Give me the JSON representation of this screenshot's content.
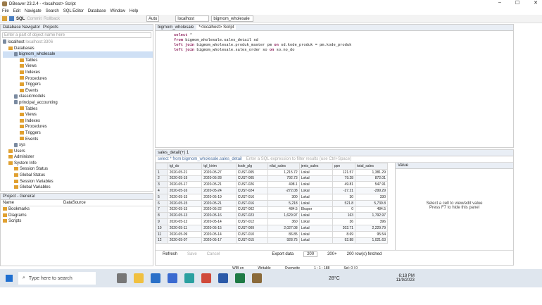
{
  "window": {
    "title": "DBeaver 23.2.4 - <localhost> Script",
    "min": "–",
    "max": "☐",
    "close": "✕"
  },
  "menu": [
    "File",
    "Edit",
    "Navigate",
    "Search",
    "SQL Editor",
    "Database",
    "Window",
    "Help"
  ],
  "toolbar": {
    "sql": "SQL",
    "commit": "Commit",
    "rollback": "Rollback",
    "auto": "Auto",
    "connection": "localhost",
    "schema": "bigmom_wholesale"
  },
  "navigator": {
    "tab1": "Database Navigator",
    "tab2": "Projects",
    "filter_placeholder": "Enter a part of object name here",
    "items": [
      {
        "label": "localhost",
        "note": "localhost:3306",
        "indent": 0,
        "type": "db"
      },
      {
        "label": "Databases",
        "indent": 1,
        "type": "fold"
      },
      {
        "label": "bigmom_wholesale",
        "indent": 2,
        "type": "db",
        "selected": true
      },
      {
        "label": "Tables",
        "indent": 3,
        "type": "fold"
      },
      {
        "label": "Views",
        "indent": 3,
        "type": "fold"
      },
      {
        "label": "Indexes",
        "indent": 3,
        "type": "fold"
      },
      {
        "label": "Procedures",
        "indent": 3,
        "type": "fold"
      },
      {
        "label": "Triggers",
        "indent": 3,
        "type": "fold"
      },
      {
        "label": "Events",
        "indent": 3,
        "type": "fold"
      },
      {
        "label": "classicmodels",
        "indent": 2,
        "type": "db"
      },
      {
        "label": "principal_accounting",
        "indent": 2,
        "type": "db"
      },
      {
        "label": "Tables",
        "indent": 3,
        "type": "fold"
      },
      {
        "label": "Views",
        "indent": 3,
        "type": "fold"
      },
      {
        "label": "Indexes",
        "indent": 3,
        "type": "fold"
      },
      {
        "label": "Procedures",
        "indent": 3,
        "type": "fold"
      },
      {
        "label": "Triggers",
        "indent": 3,
        "type": "fold"
      },
      {
        "label": "Events",
        "indent": 3,
        "type": "fold"
      },
      {
        "label": "sys",
        "indent": 2,
        "type": "db"
      },
      {
        "label": "Users",
        "indent": 1,
        "type": "fold"
      },
      {
        "label": "Administer",
        "indent": 1,
        "type": "fold"
      },
      {
        "label": "System Info",
        "indent": 1,
        "type": "fold"
      },
      {
        "label": "Session Status",
        "indent": 2,
        "type": "fold"
      },
      {
        "label": "Global Status",
        "indent": 2,
        "type": "fold"
      },
      {
        "label": "Session Variables",
        "indent": 2,
        "type": "fold"
      },
      {
        "label": "Global Variables",
        "indent": 2,
        "type": "fold"
      }
    ]
  },
  "project": {
    "title": "Project - General",
    "col1": "Name",
    "col2": "DataSource",
    "items": [
      "Bookmarks",
      "Diagrams",
      "Scripts"
    ]
  },
  "editor": {
    "tab1": "bigmom_wholesale",
    "tab2": "*<localhost> Script",
    "lines": [
      [
        {
          "t": "select",
          "k": 1
        },
        {
          "t": " *"
        }
      ],
      [
        {
          "t": "from",
          "k": 1
        },
        {
          "t": " bigmom_wholesale.sales_detail sd"
        }
      ],
      [
        {
          "t": "left join",
          "k": 1
        },
        {
          "t": " bigmom_wholesale.produk_master pm "
        },
        {
          "t": "on",
          "k": 1
        },
        {
          "t": " sd.kode_produk = pm.kode_produk"
        }
      ],
      [
        {
          "t": "left join",
          "k": 1
        },
        {
          "t": " bigmom_wholesale.sales_order so "
        },
        {
          "t": "on",
          "k": 1
        },
        {
          "t": " so.no_do"
        }
      ]
    ]
  },
  "results": {
    "tab": "sales_detail(+) 1",
    "filter_text": "select * from bigmom_wholesale.sales_detail",
    "filter_placeholder": "Enter a SQL expression to filter results (use Ctrl+Space)",
    "columns": [
      "",
      "tgl_do",
      "tgl_kirim",
      "kode_plg",
      "nilai_sales",
      "jenis_sales",
      "ppn",
      "total_sales"
    ],
    "rows": [
      [
        "1",
        "2020-05-21",
        "2020-05-27",
        "CUST-005",
        "1,215.72",
        "Lokal",
        "121.57",
        "1,381.29"
      ],
      [
        "2",
        "2020-05-19",
        "2020-05-28",
        "CUST-005",
        "792.73",
        "Lokal",
        "79.28",
        "872.01"
      ],
      [
        "3",
        "2020-05-17",
        "2020-05-21",
        "CUST-026",
        "498.1",
        "Lokal",
        "49.81",
        "547.91"
      ],
      [
        "4",
        "2020-05-16",
        "2020-05-24",
        "CUST-024",
        "-272.08",
        "Lokal",
        "-27.21",
        "-299.29"
      ],
      [
        "5",
        "2020-05-15",
        "2020-05-19",
        "CUST-016",
        "300",
        "Lokal",
        "30",
        "330"
      ],
      [
        "6",
        "2020-05-15",
        "2020-05-21",
        "CUST-016",
        "5,218",
        "Lokal",
        "521.8",
        "5,739.8"
      ],
      [
        "7",
        "2020-05-15",
        "2020-05-22",
        "CUST-002",
        "484.5",
        "Ekspor",
        "0",
        "484.5"
      ],
      [
        "8",
        "2020-05-13",
        "2020-05-16",
        "CUST-023",
        "1,629.97",
        "Lokal",
        "163",
        "1,792.97"
      ],
      [
        "9",
        "2020-05-12",
        "2020-05-14",
        "CUST-012",
        "360",
        "Lokal",
        "36",
        "396"
      ],
      [
        "10",
        "2020-05-11",
        "2020-05-15",
        "CUST-009",
        "2,027.08",
        "Lokal",
        "202.71",
        "2,229.79"
      ],
      [
        "11",
        "2020-05-09",
        "2020-05-14",
        "CUST-010",
        "86.85",
        "Lokal",
        "8.69",
        "95.54"
      ],
      [
        "12",
        "2020-05-07",
        "2020-05-17",
        "CUST-015",
        "928.75",
        "Lokal",
        "92.88",
        "1,021.63"
      ]
    ],
    "value_panel": "Value",
    "value_msg1": "Select a cell to view/edit value",
    "value_msg2": "Press F7 to hide this panel",
    "bottom": {
      "refresh": "Refresh",
      "save": "Save",
      "cancel": "Cancel",
      "export": "Export data",
      "limit": "200",
      "count": "200+",
      "fetched": "200 row(s) fetched"
    }
  },
  "status": {
    "mode": "Writable",
    "insert": "Overwrite",
    "pos": "1 : 1 : 188",
    "sel": "Sel: 0 | 0",
    "locale": "WIB en"
  },
  "taskbar": {
    "search": "Type here to search",
    "temp": "28°C",
    "time": "6:18 PM",
    "date": "11/9/2023"
  }
}
